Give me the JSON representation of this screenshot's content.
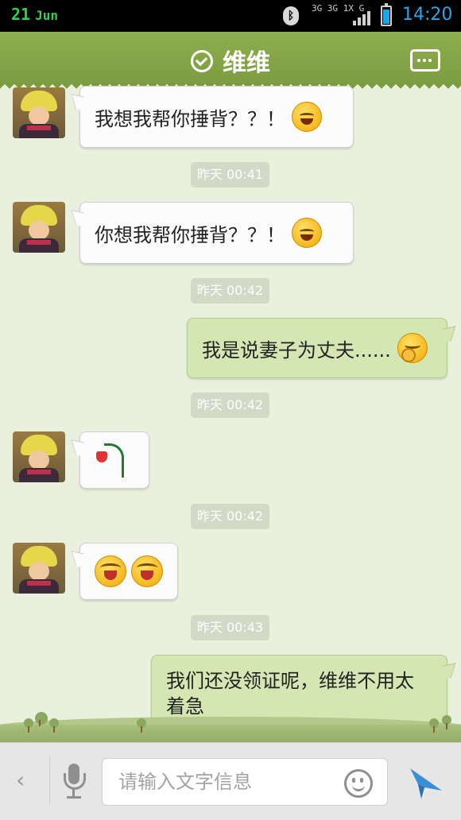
{
  "status_bar": {
    "date_day": "21",
    "date_month": "Jun",
    "network_label_1": "3G 3G 1X G",
    "time": "14:20",
    "battery_level": 0.8
  },
  "header": {
    "title": "维维"
  },
  "messages": [
    {
      "side": "left",
      "text": "我想我帮你捶背？？！",
      "emoji": "grin-emoji"
    },
    {
      "timestamp": "昨天 00:41"
    },
    {
      "side": "left",
      "text": "你想我帮你捶背？？！",
      "emoji": "grin-emoji"
    },
    {
      "timestamp": "昨天 00:42"
    },
    {
      "side": "right",
      "text": "我是说妻子为丈夫......",
      "emoji": "shy-emoji"
    },
    {
      "timestamp": "昨天 00:42"
    },
    {
      "side": "left",
      "sticker": "wilted-rose-icon"
    },
    {
      "timestamp": "昨天 00:42"
    },
    {
      "side": "left",
      "emojis": [
        "crying-emoji",
        "crying-emoji"
      ]
    },
    {
      "timestamp": "昨天 00:43"
    },
    {
      "side": "right",
      "text": "我们还没领证呢，维维不用太着急"
    }
  ],
  "input_bar": {
    "placeholder": "请输入文字信息",
    "back_icon": "chevron-left-icon",
    "voice_icon": "microphone-icon",
    "emoji_icon": "smiley-icon",
    "send_icon": "send-icon"
  },
  "colors": {
    "header": "#86a548",
    "chat_background": "#e9f0dd",
    "outgoing_bubble": "#d4e6b2",
    "incoming_bubble": "#fbfbfb",
    "time_accent": "#2aa6e8",
    "send_accent": "#3a8ed8"
  }
}
